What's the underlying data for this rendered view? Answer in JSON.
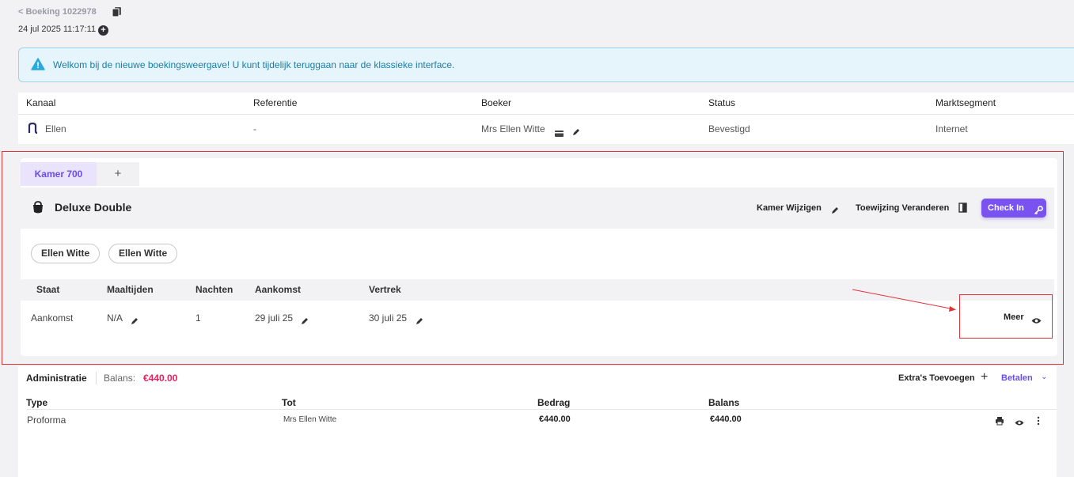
{
  "booking": {
    "back_label": "< Boeking 1022978",
    "timestamp": "24 jul 2025 11:17:11"
  },
  "banner": {
    "message": "Welkom bij de nieuwe boekingsweergave! U kunt tijdelijk teruggaan naar de klassieke interface."
  },
  "info": {
    "headers": [
      "Kanaal",
      "Referentie",
      "Boeker",
      "Status",
      "Marktsegment"
    ],
    "channel": "Ellen",
    "reference": "-",
    "booker": "Mrs Ellen Witte",
    "status": "Bevestigd",
    "segment": "Internet"
  },
  "room": {
    "tab_label": "Kamer 700",
    "tab_add": "+",
    "name": "Deluxe Double",
    "change_room": "Kamer Wijzigen",
    "change_assignment": "Toewijzing Veranderen",
    "checkin": "Check In",
    "guests": [
      "Ellen Witte",
      "Ellen Witte"
    ]
  },
  "stay": {
    "headers": [
      "Staat",
      "Maaltijden",
      "Nachten",
      "Aankomst",
      "Vertrek"
    ],
    "state": "Aankomst",
    "meals": "N/A",
    "nights": "1",
    "arrival": "29 juli 25",
    "departure": "30 juli 25",
    "more": "Meer"
  },
  "admin": {
    "title": "Administratie",
    "balance_label": "Balans:",
    "balance_value": "€440.00",
    "extras": "Extra's Toevoegen",
    "pay": "Betalen",
    "headers": [
      "Type",
      "Tot",
      "Bedrag",
      "Balans"
    ],
    "rows": [
      {
        "type": "Proforma",
        "to": "Mrs Ellen Witte",
        "amount": "€440.00",
        "balance": "€440.00"
      }
    ]
  },
  "colors": {
    "accent": "#7a52f0",
    "highlight": "#e0343a",
    "balance": "#e0245e",
    "banner_text": "#1a7ea6"
  }
}
